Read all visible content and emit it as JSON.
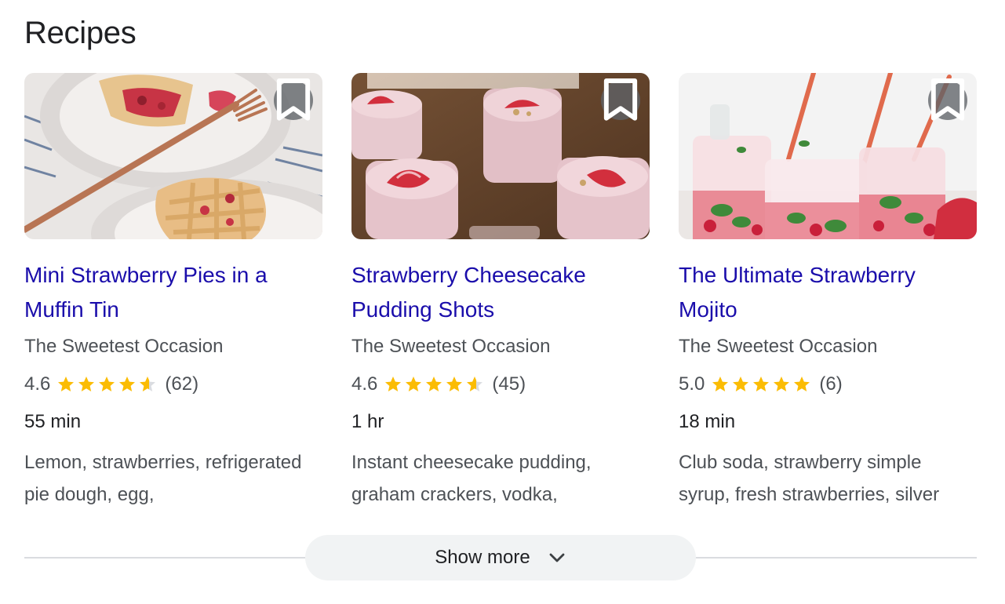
{
  "section": {
    "title": "Recipes"
  },
  "recipes": [
    {
      "title": "Mini Strawberry Pies in a Muffin Tin",
      "source": "The Sweetest Occasion",
      "rating": "4.6",
      "rating_value": 4.6,
      "reviews": "(62)",
      "time": "55 min",
      "ingredients": "Lemon, strawberries, refrigerated pie dough, egg,"
    },
    {
      "title": "Strawberry Cheesecake Pudding Shots",
      "source": "The Sweetest Occasion",
      "rating": "4.6",
      "rating_value": 4.6,
      "reviews": "(45)",
      "time": "1 hr",
      "ingredients": "Instant cheesecake pudding, graham crackers, vodka,"
    },
    {
      "title": "The Ultimate Strawberry Mojito",
      "source": "The Sweetest Occasion",
      "rating": "5.0",
      "rating_value": 5.0,
      "reviews": "(6)",
      "time": "18 min",
      "ingredients": "Club soda, strawberry simple syrup, fresh strawberries, silver"
    }
  ],
  "show_more": {
    "label": "Show more",
    "icon": "chevron-down-icon"
  },
  "icons": {
    "save": "bookmark-icon",
    "star": "star-icon"
  },
  "colors": {
    "link": "#1a0dab",
    "star": "#fbbc04",
    "star_empty": "#dadce0",
    "text_muted": "#4d5156"
  }
}
